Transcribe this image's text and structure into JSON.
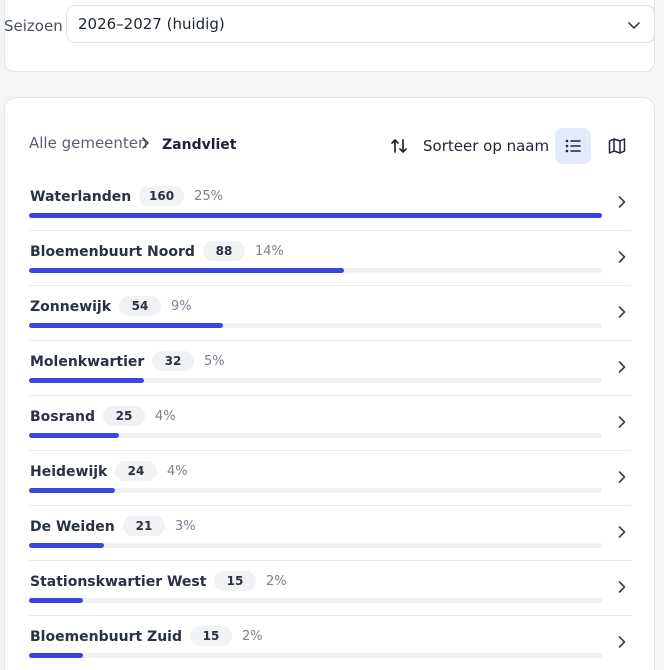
{
  "season": {
    "label": "Seizoen",
    "selected": "2026–2027 (huidig)"
  },
  "breadcrumb": {
    "root": "Alle gemeenten",
    "current": "Zandvliet"
  },
  "toolbar": {
    "sort_label": "Sorteer op naam",
    "active_view": "list"
  },
  "colors": {
    "accent": "#3a46e0",
    "track": "#eef0f3",
    "active_view_bg": "#e4e9fb"
  },
  "neighbourhoods": [
    {
      "name": "Waterlanden",
      "count": "160",
      "percent": "25%",
      "share": 1.0
    },
    {
      "name": "Bloemenbuurt Noord",
      "count": "88",
      "percent": "14%",
      "share": 0.55
    },
    {
      "name": "Zonnewijk",
      "count": "54",
      "percent": "9%",
      "share": 0.338
    },
    {
      "name": "Molenkwartier",
      "count": "32",
      "percent": "5%",
      "share": 0.2
    },
    {
      "name": "Bosrand",
      "count": "25",
      "percent": "4%",
      "share": 0.157
    },
    {
      "name": "Heidewijk",
      "count": "24",
      "percent": "4%",
      "share": 0.15
    },
    {
      "name": "De Weiden",
      "count": "21",
      "percent": "3%",
      "share": 0.131
    },
    {
      "name": "Stationskwartier West",
      "count": "15",
      "percent": "2%",
      "share": 0.094
    },
    {
      "name": "Bloemenbuurt Zuid",
      "count": "15",
      "percent": "2%",
      "share": 0.094
    }
  ]
}
